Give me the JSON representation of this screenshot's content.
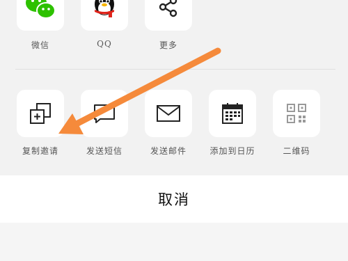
{
  "share_row": [
    {
      "label": "微信",
      "icon": "wechat-icon"
    },
    {
      "label": "QQ",
      "icon": "qq-penguin-icon"
    },
    {
      "label": "更多",
      "icon": "share-icon"
    }
  ],
  "action_row": [
    {
      "label": "复制邀请",
      "icon": "copy-icon"
    },
    {
      "label": "发送短信",
      "icon": "sms-icon"
    },
    {
      "label": "发送邮件",
      "icon": "mail-icon"
    },
    {
      "label": "添加到日历",
      "icon": "calendar-icon"
    },
    {
      "label": "二维码",
      "icon": "qr-code-icon"
    }
  ],
  "cancel_label": "取消",
  "colors": {
    "wechat": "#2dc100",
    "arrow": "#f58a3b",
    "panel": "#f2f2f2",
    "tile": "#ffffff"
  }
}
